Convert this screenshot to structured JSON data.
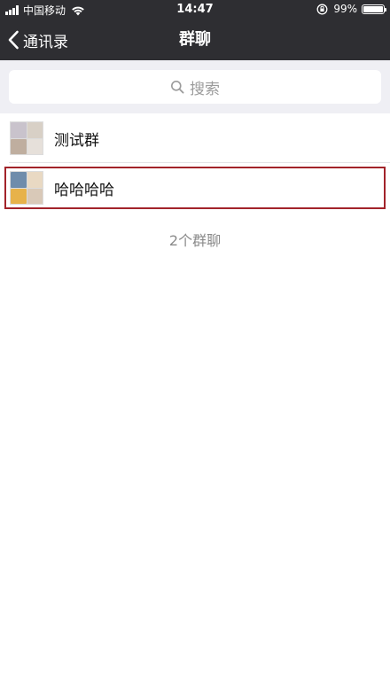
{
  "status_bar": {
    "carrier": "中国移动",
    "time": "14:47",
    "battery_percent": "99%",
    "battery_level": 0.99
  },
  "nav": {
    "back_label": "通讯录",
    "title": "群聊"
  },
  "search": {
    "placeholder": "搜索"
  },
  "groups": [
    {
      "name": "测试群",
      "avatar_colors": [
        "#c9c3cc",
        "#d8d0c6",
        "#bfae9f",
        "#e6e0da"
      ]
    },
    {
      "name": "哈哈哈哈",
      "avatar_colors": [
        "#6f8cab",
        "#e9d9c3",
        "#e7b24a",
        "#d9c9b8"
      ],
      "selected": true
    }
  ],
  "footer": {
    "count_label": "2个群聊"
  },
  "colors": {
    "bar_bg": "#2e2e32",
    "search_bg": "#efeff4",
    "selection_outline": "#a2232a"
  }
}
